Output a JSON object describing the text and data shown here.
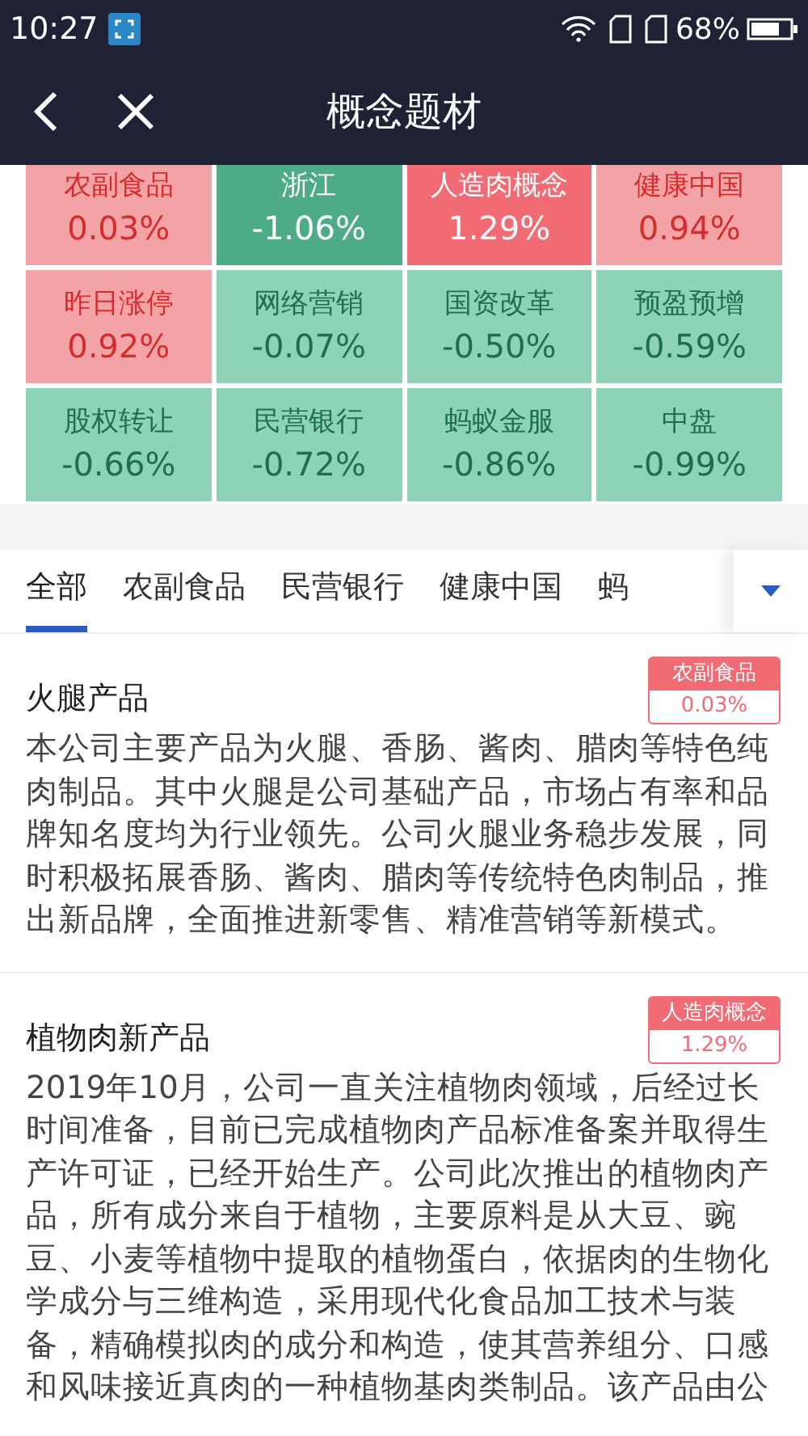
{
  "status_bar": {
    "time": "10:27",
    "battery": "68%"
  },
  "header": {
    "title": "概念题材"
  },
  "tiles": [
    {
      "name": "农副食品",
      "change": "0.03%",
      "kind": "up-light"
    },
    {
      "name": "浙江",
      "change": "-1.06%",
      "kind": "down-strong"
    },
    {
      "name": "人造肉概念",
      "change": "1.29%",
      "kind": "up-strong"
    },
    {
      "name": "健康中国",
      "change": "0.94%",
      "kind": "up-light"
    },
    {
      "name": "昨日涨停",
      "change": "0.92%",
      "kind": "up-light"
    },
    {
      "name": "网络营销",
      "change": "-0.07%",
      "kind": "down-light"
    },
    {
      "name": "国资改革",
      "change": "-0.50%",
      "kind": "down-light"
    },
    {
      "name": "预盈预增",
      "change": "-0.59%",
      "kind": "down-light"
    },
    {
      "name": "股权转让",
      "change": "-0.66%",
      "kind": "down-light"
    },
    {
      "name": "民营银行",
      "change": "-0.72%",
      "kind": "down-light"
    },
    {
      "name": "蚂蚁金服",
      "change": "-0.86%",
      "kind": "down-light"
    },
    {
      "name": "中盘",
      "change": "-0.99%",
      "kind": "down-light"
    }
  ],
  "tabs": [
    {
      "label": "全部",
      "selected": true
    },
    {
      "label": "农副食品",
      "selected": false
    },
    {
      "label": "民营银行",
      "selected": false
    },
    {
      "label": "健康中国",
      "selected": false
    },
    {
      "label": "蚂",
      "selected": false
    }
  ],
  "articles": [
    {
      "title": "火腿产品",
      "tag": {
        "name": "农副食品",
        "change": "0.03%"
      },
      "body": "本公司主要产品为火腿、香肠、酱肉、腊肉等特色纯肉制品。其中火腿是公司基础产品，市场占有率和品牌知名度均为行业领先。公司火腿业务稳步发展，同时积极拓展香肠、酱肉、腊肉等传统特色肉制品，推出新品牌，全面推进新零售、精准营销等新模式。"
    },
    {
      "title": "植物肉新产品",
      "tag": {
        "name": "人造肉概念",
        "change": "1.29%"
      },
      "body": "2019年10月，公司一直关注植物肉领域，后经过长时间准备，目前已完成植物肉产品标准备案并取得生产许可证，已经开始生产。公司此次推出的植物肉产品，所有成分来自于植物，主要原料是从大豆、豌豆、小麦等植物中提取的植物蛋白，依据肉的生物化学成分与三维构造，采用现代化食品加工技术与装备，精确模拟肉的成分和构造，使其营养组分、口感和风味接近真肉的一种植物基肉类制品。该产品由公"
    }
  ]
}
